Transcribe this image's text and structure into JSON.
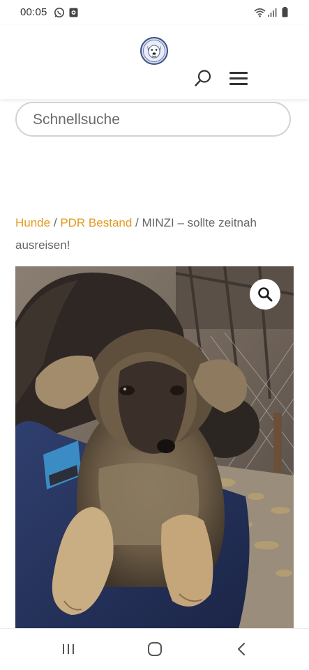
{
  "status_bar": {
    "time": "00:05",
    "left_icons": [
      "whatsapp-icon",
      "notification-app-icon"
    ],
    "right_icons": [
      "wifi-icon",
      "signal-icon",
      "battery-icon"
    ]
  },
  "header": {
    "logo": "dog-logo",
    "search_icon": "search-icon",
    "menu_icon": "hamburger-menu-icon"
  },
  "quick_search": {
    "placeholder": "Schnellsuche",
    "value": ""
  },
  "breadcrumb": {
    "items": [
      {
        "label": "Hunde",
        "link": true
      },
      {
        "label": "PDR Bestand",
        "link": true
      }
    ],
    "separator": "/",
    "current": "MINZI – sollte zeitnah ausreisen!"
  },
  "colors": {
    "link": "#e09a1e",
    "text": "#666666",
    "header_bg": "#ffffff"
  },
  "product_image": {
    "subject": "puppy held in arms",
    "zoom_icon": "magnifier-icon"
  },
  "nav_bar": {
    "buttons": [
      "recent-apps-icon",
      "home-icon",
      "back-icon"
    ]
  }
}
